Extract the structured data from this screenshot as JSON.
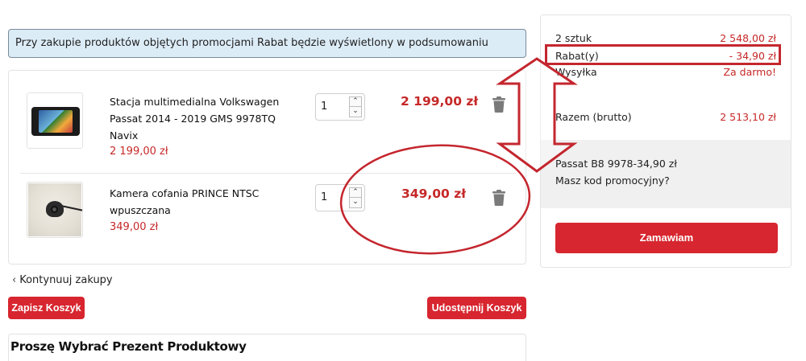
{
  "banner": {
    "text": "Przy zakupie produktów objętych promocjami Rabat będzie wyświetlony w podsumowaniu"
  },
  "cart": {
    "items": [
      {
        "name_line1": "Stacja multimedialna Volkswagen",
        "name_line2": "Passat 2014 - 2019 GMS 9978TQ",
        "name_line3": "Navix",
        "unit_price": "2 199,00 zł",
        "quantity": "1",
        "line_price": "2 199,00 zł"
      },
      {
        "name_line1": "Kamera cofania PRINCE NTSC",
        "name_line2": "wpuszczana",
        "unit_price": "349,00 zł",
        "quantity": "1",
        "line_price": "349,00 zł"
      }
    ],
    "continue_label": "Kontynuuj zakupy",
    "save_cart_label": "Zapisz Koszyk",
    "share_cart_label": "Udostępnij Koszyk",
    "gift_title": "Proszę Wybrać Prezent Produktowy"
  },
  "summary": {
    "items_label": "2 sztuk",
    "items_value": "2 548,00 zł",
    "discount_label": "Rabat(y)",
    "discount_value": "- 34,90 zł",
    "shipping_label": "Wysyłka",
    "shipping_value": "Za darmo!",
    "total_label": "Razem (brutto)",
    "total_value": "2 513,10 zł",
    "promo_code_applied": "Passat B8 9978",
    "promo_code_amount": "-34,90 zł",
    "promo_question": "Masz kod promocyjny?",
    "order_button": "Zamawiam"
  },
  "colors": {
    "accent_red": "#d7262f",
    "price_red": "#c62828",
    "banner_bg": "#dcecf7",
    "annotation_red": "#c4262e"
  },
  "icons": {
    "trash": "trash-icon",
    "chevron_left": "chevron-left-icon",
    "spinner_up": "chevron-up-icon",
    "spinner_down": "chevron-down-icon"
  }
}
